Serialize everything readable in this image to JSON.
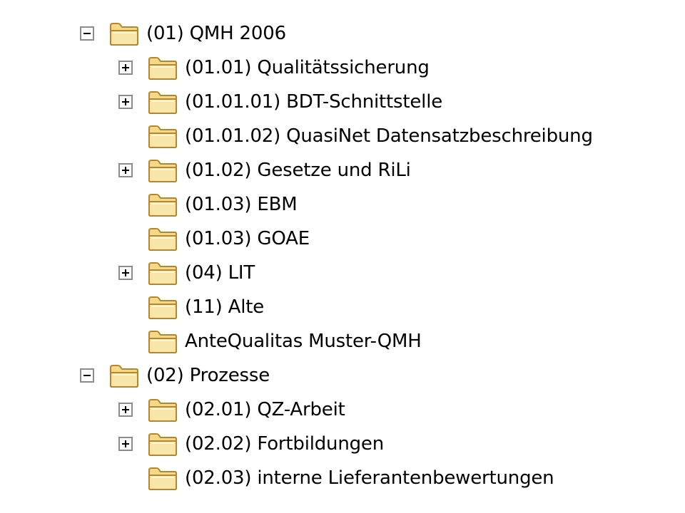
{
  "tree": {
    "items": [
      {
        "label": "(01) QMH 2006",
        "level": 0,
        "toggle": "minus",
        "icon": "folder-icon"
      },
      {
        "label": "(01.01) Qualitätssicherung",
        "level": 1,
        "toggle": "plus",
        "icon": "folder-icon"
      },
      {
        "label": "(01.01.01) BDT-Schnittstelle",
        "level": 1,
        "toggle": "plus",
        "icon": "folder-icon"
      },
      {
        "label": "(01.01.02) QuasiNet Datensatzbeschreibung",
        "level": 1,
        "toggle": "none",
        "icon": "folder-icon"
      },
      {
        "label": "(01.02) Gesetze und RiLi",
        "level": 1,
        "toggle": "plus",
        "icon": "folder-icon"
      },
      {
        "label": "(01.03) EBM",
        "level": 1,
        "toggle": "none",
        "icon": "folder-icon"
      },
      {
        "label": "(01.03) GOAE",
        "level": 1,
        "toggle": "none",
        "icon": "folder-icon"
      },
      {
        "label": "(04) LIT",
        "level": 1,
        "toggle": "plus",
        "icon": "folder-icon"
      },
      {
        "label": "(11) Alte",
        "level": 1,
        "toggle": "none",
        "icon": "folder-icon"
      },
      {
        "label": "AnteQualitas Muster-QMH",
        "level": 1,
        "toggle": "none",
        "icon": "folder-icon"
      },
      {
        "label": "(02) Prozesse",
        "level": 0,
        "toggle": "minus",
        "icon": "folder-icon"
      },
      {
        "label": "(02.01) QZ-Arbeit",
        "level": 1,
        "toggle": "plus",
        "icon": "folder-icon"
      },
      {
        "label": "(02.02) Fortbildungen",
        "level": 1,
        "toggle": "plus",
        "icon": "folder-icon"
      },
      {
        "label": "(02.03) interne Lieferantenbewertungen",
        "level": 1,
        "toggle": "none",
        "icon": "folder-icon"
      }
    ]
  },
  "colors": {
    "folder_fill": "#f3d98a",
    "folder_stroke": "#b8862a",
    "toggle_border": "#8c8c8c"
  }
}
